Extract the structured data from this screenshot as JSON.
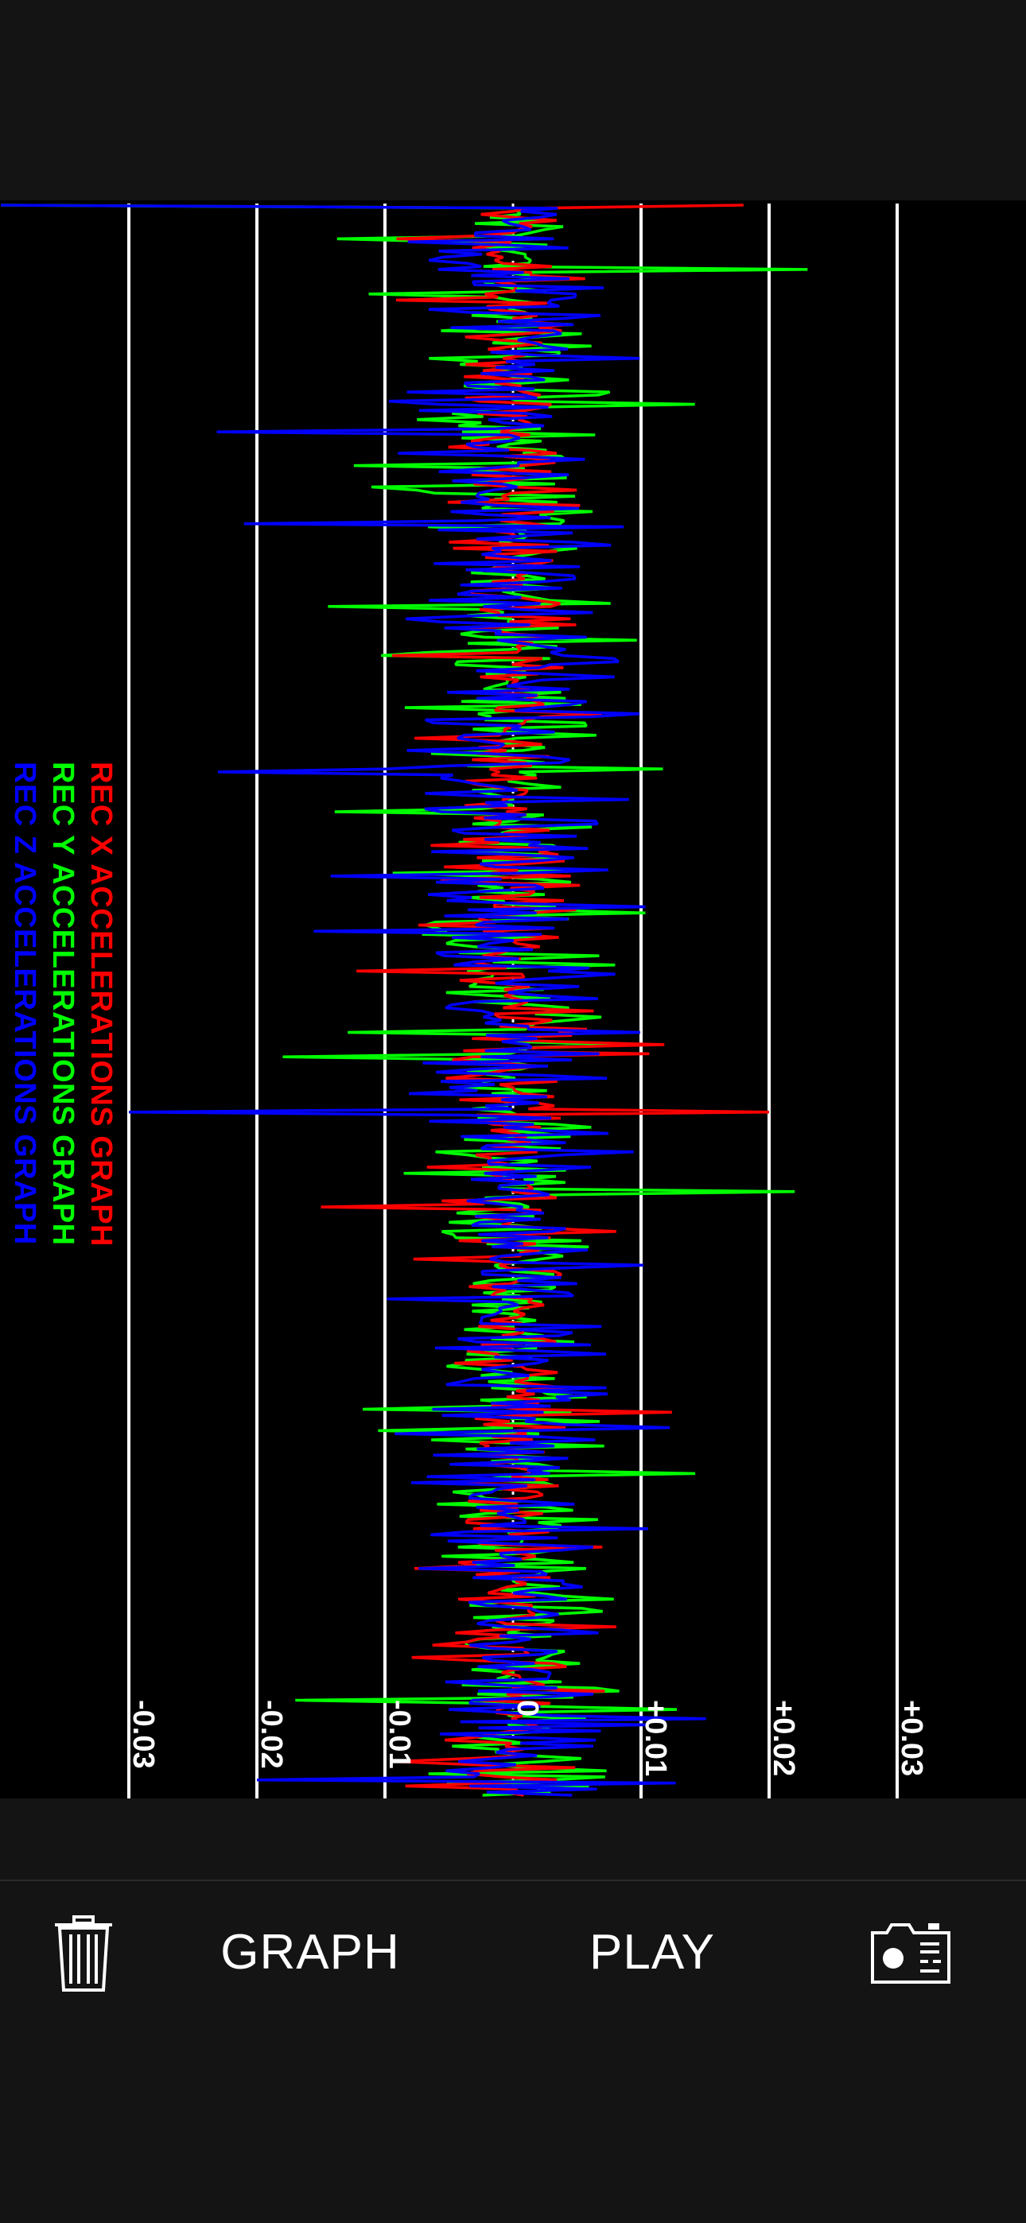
{
  "chart_data": {
    "type": "line",
    "orientation": "rotated-90",
    "title": "",
    "series": [
      {
        "name": "REC X ACCELERATIONS GRAPH",
        "color": "#ff0000",
        "amplitude": 0.0045,
        "spikes": [
          [
            0.0,
            0.018
          ],
          [
            0.57,
            0.02
          ],
          [
            0.63,
            -0.015
          ]
        ]
      },
      {
        "name": "REC Y ACCELERATIONS GRAPH",
        "color": "#00ff00",
        "amplitude": 0.0065,
        "spikes": [
          [
            0.0,
            -0.04
          ],
          [
            0.04,
            0.023
          ],
          [
            0.62,
            0.022
          ],
          [
            0.94,
            -0.017
          ]
        ]
      },
      {
        "name": "REC Z ACCELERATIONS GRAPH",
        "color": "#0000ff",
        "amplitude": 0.0075,
        "spikes": [
          [
            0.0,
            -0.04
          ],
          [
            0.57,
            -0.03
          ],
          [
            0.2,
            -0.021
          ],
          [
            0.99,
            -0.02
          ]
        ]
      }
    ],
    "ylim": [
      -0.04,
      0.03
    ],
    "ticks": [
      "-0.03",
      "-0.02",
      "-0.01",
      "0",
      "+0.01",
      "+0.02",
      "+0.03"
    ],
    "tick_values": [
      -0.03,
      -0.02,
      -0.01,
      0,
      0.01,
      0.02,
      0.03
    ],
    "grid": true,
    "legend_position": "left"
  },
  "toolbar": {
    "trash_icon": "trash-icon",
    "graph_label": "GRAPH",
    "play_label": "PLAY",
    "camera_icon": "camera-icon"
  },
  "colors": {
    "background": "#141414",
    "plot_background": "#000000",
    "grid": "#ffffff",
    "x": "#ff0000",
    "y": "#00ff00",
    "z": "#0000ff"
  }
}
